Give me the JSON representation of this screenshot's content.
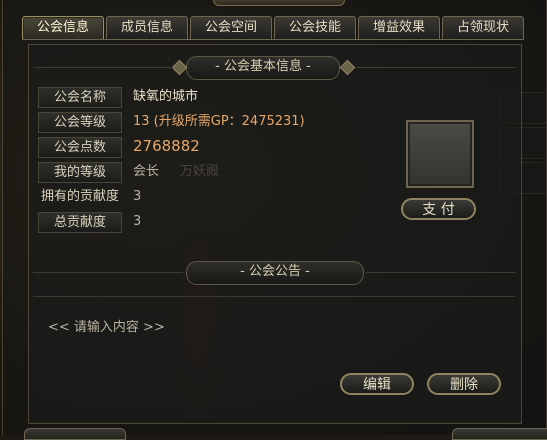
{
  "window": {
    "tabs": [
      {
        "label": "公会信息",
        "active": true
      },
      {
        "label": "成员信息",
        "active": false
      },
      {
        "label": "公会空间",
        "active": false
      },
      {
        "label": "公会技能",
        "active": false
      },
      {
        "label": "增益效果",
        "active": false
      },
      {
        "label": "占领现状",
        "active": false
      }
    ]
  },
  "basic_info": {
    "title": "- 公会基本信息 -",
    "rows": [
      {
        "label": "公会名称",
        "value": "缺氧的城市",
        "value_color": "#e8e2cc"
      },
      {
        "label": "公会等级",
        "value": "13 (升级所需GP：2475231)",
        "value_color": "#e6a86a"
      },
      {
        "label": "公会点数",
        "value": "2768882",
        "value_color": "#e6a86a"
      },
      {
        "label": "我的等级",
        "value": "会长",
        "value_color": "#b8b2a0"
      },
      {
        "label": "拥有的贡献度",
        "value": "3",
        "value_color": "#b8b2a0"
      },
      {
        "label": "总贡献度",
        "value": "3",
        "value_color": "#b8b2a0"
      }
    ],
    "pay_button": "支  付"
  },
  "notice": {
    "title": "- 公会公告 -",
    "placeholder": "<< 请输入内容 >>",
    "edit_button": "编辑",
    "delete_button": "删除"
  },
  "background_text": {
    "name_tag": "万妖殿"
  }
}
